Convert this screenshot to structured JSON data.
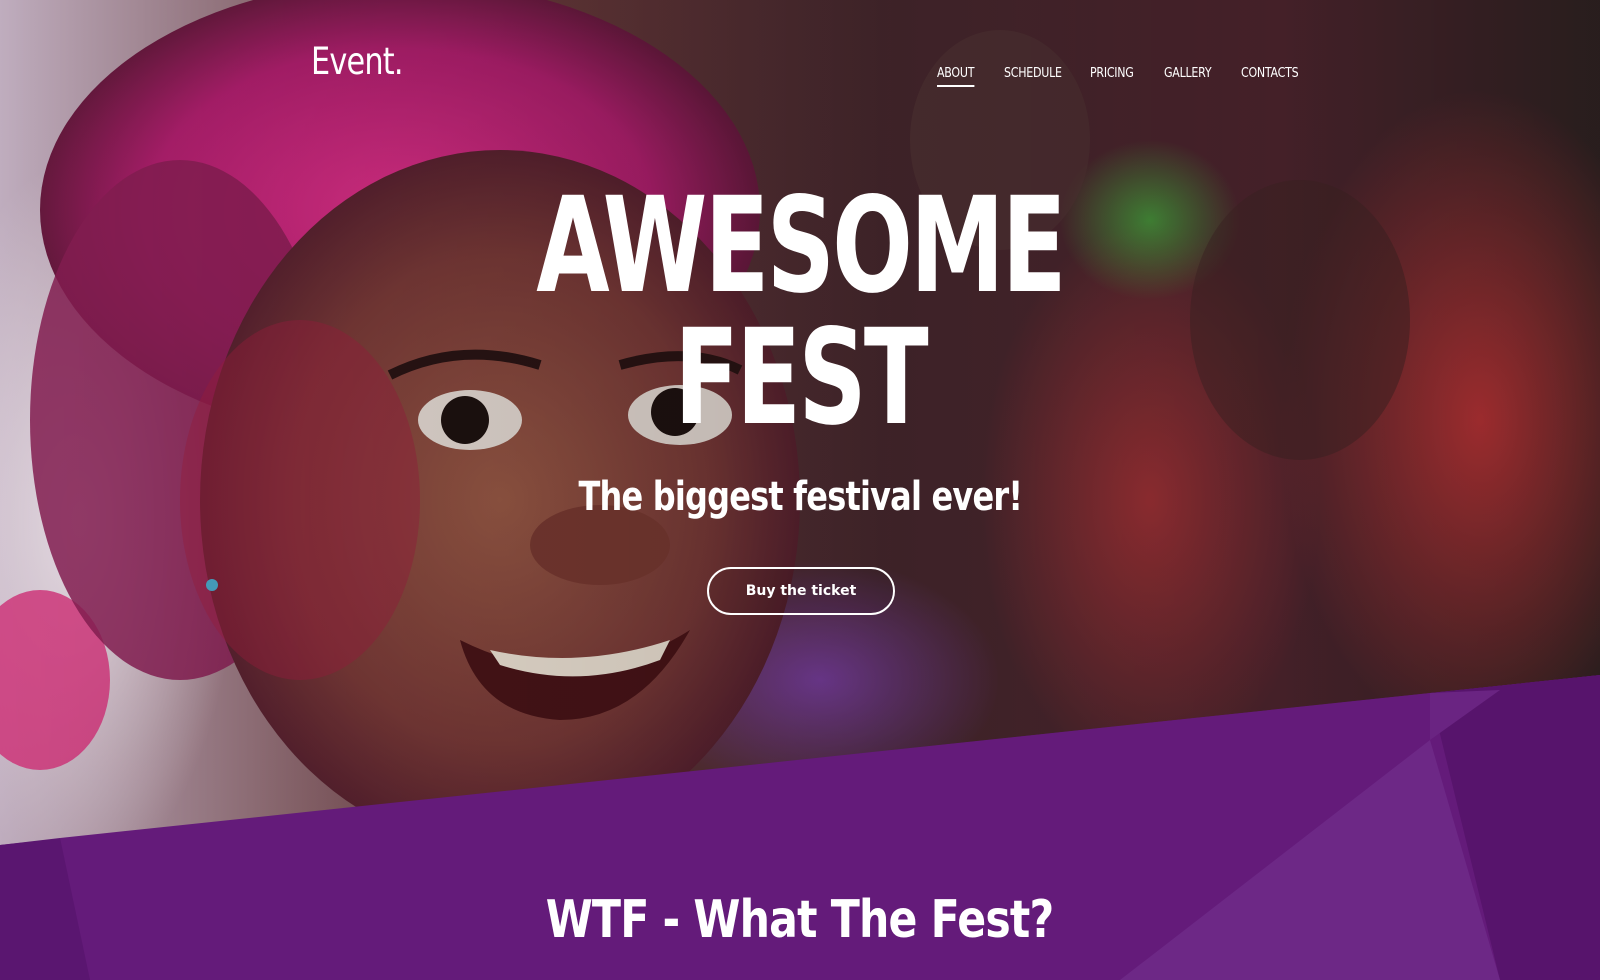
{
  "brand": {
    "logo_text": "Event."
  },
  "nav": {
    "items": [
      {
        "label": "ABOUT",
        "active": true
      },
      {
        "label": "SCHEDULE",
        "active": false
      },
      {
        "label": "PRICING",
        "active": false
      },
      {
        "label": "GALLERY",
        "active": false
      },
      {
        "label": "CONTACTS",
        "active": false
      }
    ]
  },
  "hero": {
    "title_line1": "AWESOME",
    "title_line2": "FEST",
    "subtitle": "The biggest festival ever!",
    "cta_label": "Buy the ticket"
  },
  "about": {
    "title": "WTF - What The Fest?"
  },
  "colors": {
    "purple_primary": "#621a78",
    "purple_light": "#6e2a86",
    "purple_dark": "#4f1363",
    "text": "#ffffff"
  }
}
